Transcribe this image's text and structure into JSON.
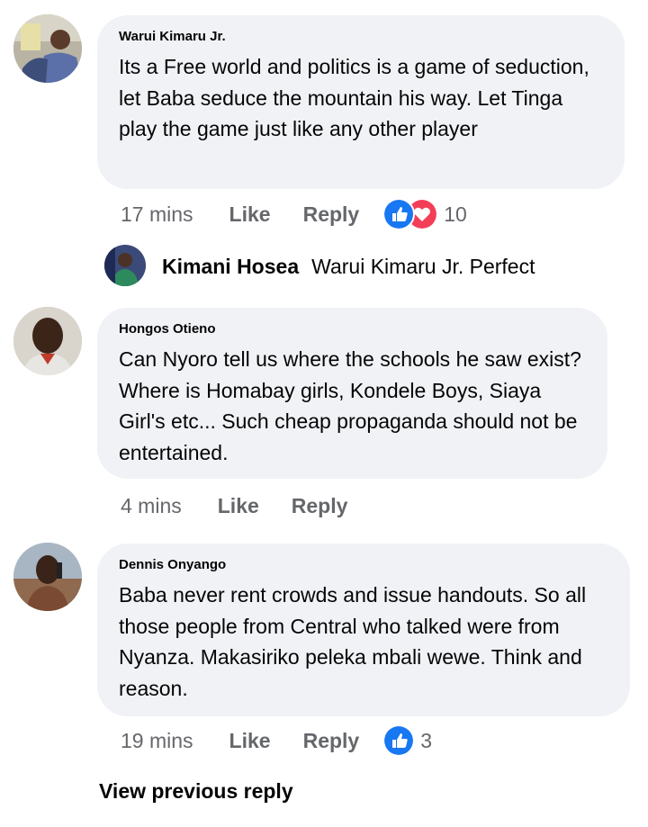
{
  "comments": [
    {
      "author": "Warui Kimaru Jr.",
      "text": "Its a Free world and politics is a game of seduction, let Baba seduce the mountain his way. Let Tinga play the game just like any other player",
      "time": "17 mins",
      "like_label": "Like",
      "reply_label": "Reply",
      "reactions": [
        "like",
        "love"
      ],
      "reaction_count": "10"
    },
    {
      "author": "Hongos Otieno",
      "text": "Can Nyoro tell us where the schools he saw exist? Where is Homabay girls, Kondele Boys, Siaya Girl's etc... Such cheap propaganda should not be entertained.",
      "time": "4 mins",
      "like_label": "Like",
      "reply_label": "Reply"
    },
    {
      "author": "Dennis Onyango",
      "text": "Baba never rent crowds and issue handouts. So all those people from Central who talked were from Nyanza. Makasiriko peleka mbali wewe. Think and reason.",
      "time": "19 mins",
      "like_label": "Like",
      "reply_label": "Reply",
      "reactions": [
        "like"
      ],
      "reaction_count": "3"
    }
  ],
  "reply": {
    "author": "Kimani Hosea",
    "text": "Warui Kimaru Jr. Perfect"
  },
  "view_previous_label": "View previous reply",
  "colors": {
    "bubble": "#f0f2f5",
    "meta": "#65676b",
    "like_blue": "#1877f2",
    "love_red": "#f33e58"
  }
}
